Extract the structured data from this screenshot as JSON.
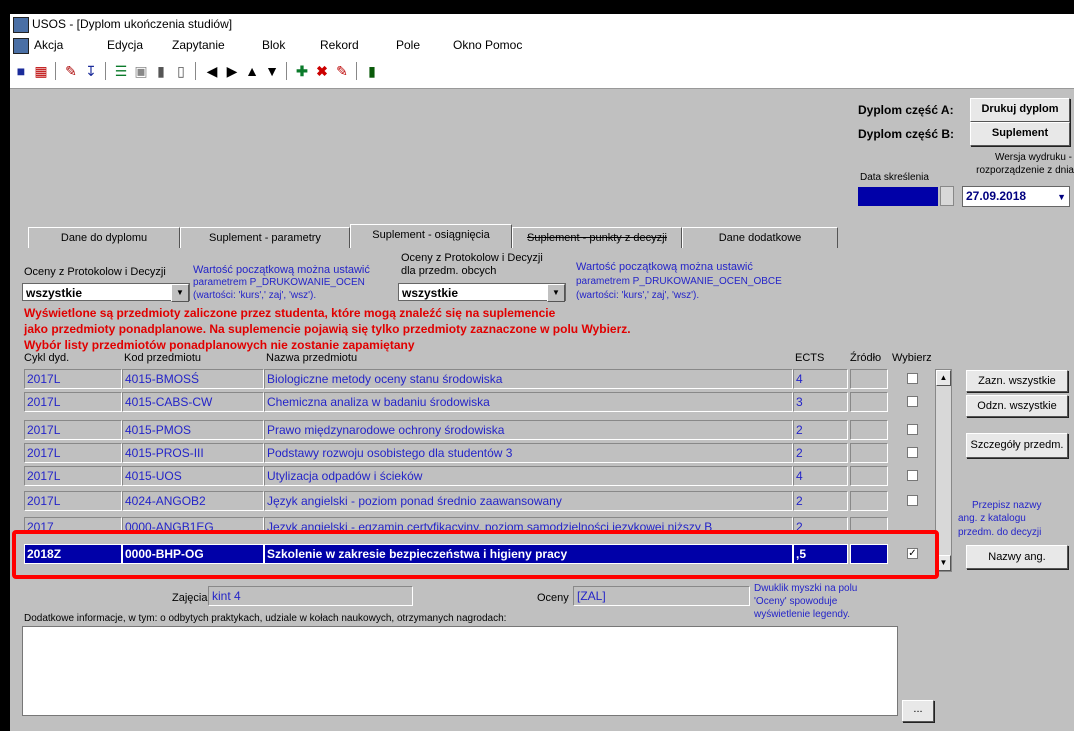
{
  "window": {
    "title": "USOS - [Dyplom ukończenia studiów]"
  },
  "menu": [
    "Akcja",
    "Edycja",
    "Zapytanie",
    "Blok",
    "Rekord",
    "Pole",
    "Okno",
    "Pomoc"
  ],
  "toolbar": {
    "icons": [
      "save-icon",
      "print-preview-icon",
      "edit-icon",
      "download-icon",
      "filter-icon",
      "layout-icon",
      "chart-bar-icon",
      "chart-bar2-icon",
      "first-record-icon",
      "last-record-icon",
      "prev-record-icon",
      "next-record-icon",
      "add-record-icon",
      "delete-record-icon",
      "clear-icon",
      "exit-icon"
    ]
  },
  "right_panel": {
    "dyplom_a_label": "Dyplom część A:",
    "dyplom_a_btn": "Drukuj dyplom",
    "dyplom_b_label": "Dyplom część B:",
    "dyplom_b_btn": "Suplement",
    "wersja_label_1": "Wersja wydruku -",
    "wersja_label_2": "rozporządzenie z dnia",
    "data_skreslenia": "Data skreślenia",
    "wersja_value": "27.09.2018"
  },
  "tabs": [
    "Dane do dyplomu",
    "Suplement - parametry",
    "Suplement - osiągnięcia",
    "Suplement - punkty z decyzji",
    "Dane dodatkowe"
  ],
  "filters": {
    "oceny_label": "Oceny z Protokolow i Decyzji",
    "oceny_value": "wszystkie",
    "oceny_note_1": "Wartość początkową można ustawić",
    "oceny_note_2": "parametrem P_DRUKOWANIE_OCEN",
    "oceny_note_3": "(wartości: 'kurs',' zaj', 'wsz').",
    "obce_label_1": "Oceny z Protokolow i Decyzji",
    "obce_label_2": "dla przedm. obcych",
    "obce_value": "wszystkie",
    "obce_note_1": "Wartość początkową można ustawić",
    "obce_note_2": "parametrem P_DRUKOWANIE_OCEN_OBCE",
    "obce_note_3": "(wartości: 'kurs',' zaj', 'wsz')."
  },
  "warning": {
    "line1": "Wyświetlone są przedmioty zaliczone przez studenta, które mogą znaleźć się na suplemencie",
    "line2": "jako przedmioty ponadplanowe. Na suplemencie pojawią się tylko przedmioty zaznaczone w polu Wybierz.",
    "line3": "Wybór listy przedmiotów ponadplanowych nie zostanie zapamiętany"
  },
  "table": {
    "headers": [
      "Cykl dyd.",
      "Kod przedmiotu",
      "Nazwa przedmiotu",
      "ECTS",
      "Źródło",
      "Wybierz"
    ],
    "rows": [
      {
        "cykl": "2017L",
        "kod": "4015-BMOSŚ",
        "nazwa": "Biologiczne metody oceny stanu środowiska",
        "ects": "4",
        "zrodlo": "",
        "checked": false
      },
      {
        "cykl": "2017L",
        "kod": "4015-CABS-CW",
        "nazwa": "Chemiczna analiza w badaniu środowiska",
        "ects": "3",
        "zrodlo": "",
        "checked": false
      },
      {
        "cykl": "2017L",
        "kod": "4015-PMOS",
        "nazwa": "Prawo międzynarodowe ochrony środowiska",
        "ects": "2",
        "zrodlo": "",
        "checked": false
      },
      {
        "cykl": "2017L",
        "kod": "4015-PROS-III",
        "nazwa": "Podstawy rozwoju osobistego dla studentów 3",
        "ects": "2",
        "zrodlo": "",
        "checked": false
      },
      {
        "cykl": "2017L",
        "kod": "4015-UOS",
        "nazwa": "Utylizacja odpadów i ścieków",
        "ects": "4",
        "zrodlo": "",
        "checked": false
      },
      {
        "cykl": "2017L",
        "kod": "4024-ANGOB2",
        "nazwa": "Język angielski - poziom ponad średnio zaawansowany",
        "ects": "2",
        "zrodlo": "",
        "checked": false
      },
      {
        "cykl": "2017",
        "kod": "0000-ANGB1EG",
        "nazwa": "Język angielski - egzamin certyfikacyjny, poziom samodzielności językowej niższy B",
        "ects": "2",
        "zrodlo": "",
        "checked": false
      },
      {
        "cykl": "2018Z",
        "kod": "0000-BHP-OG",
        "nazwa": "Szkolenie w zakresie bezpieczeństwa i higieny pracy",
        "ects": ",5",
        "zrodlo": "",
        "checked": true
      }
    ]
  },
  "side_buttons": {
    "zazn": "Zazn. wszystkie",
    "odzn": "Odzn. wszystkie",
    "szczegoly": "Szczegóły przedm.",
    "przepisz_1": "Przepisz nazwy",
    "przepisz_2": "ang. z katalogu",
    "przepisz_3": "przedm. do decyzji",
    "nazwy": "Nazwy ang."
  },
  "details": {
    "zajecia_label": "Zajęcia",
    "zajecia_value": "kint 4",
    "oceny_label": "Oceny",
    "oceny_value": "[ZAL]",
    "hint_1": "Dwuklik myszki na polu",
    "hint_2": "'Oceny' spowoduje",
    "hint_3": "wyświetlenie legendy.",
    "dodatkowe_label": "Dodatkowe informacje, w tym: o odbytych praktykach, udziale w kołach naukowych, otrzymanych nagrodach:",
    "ellipsis": "..."
  }
}
